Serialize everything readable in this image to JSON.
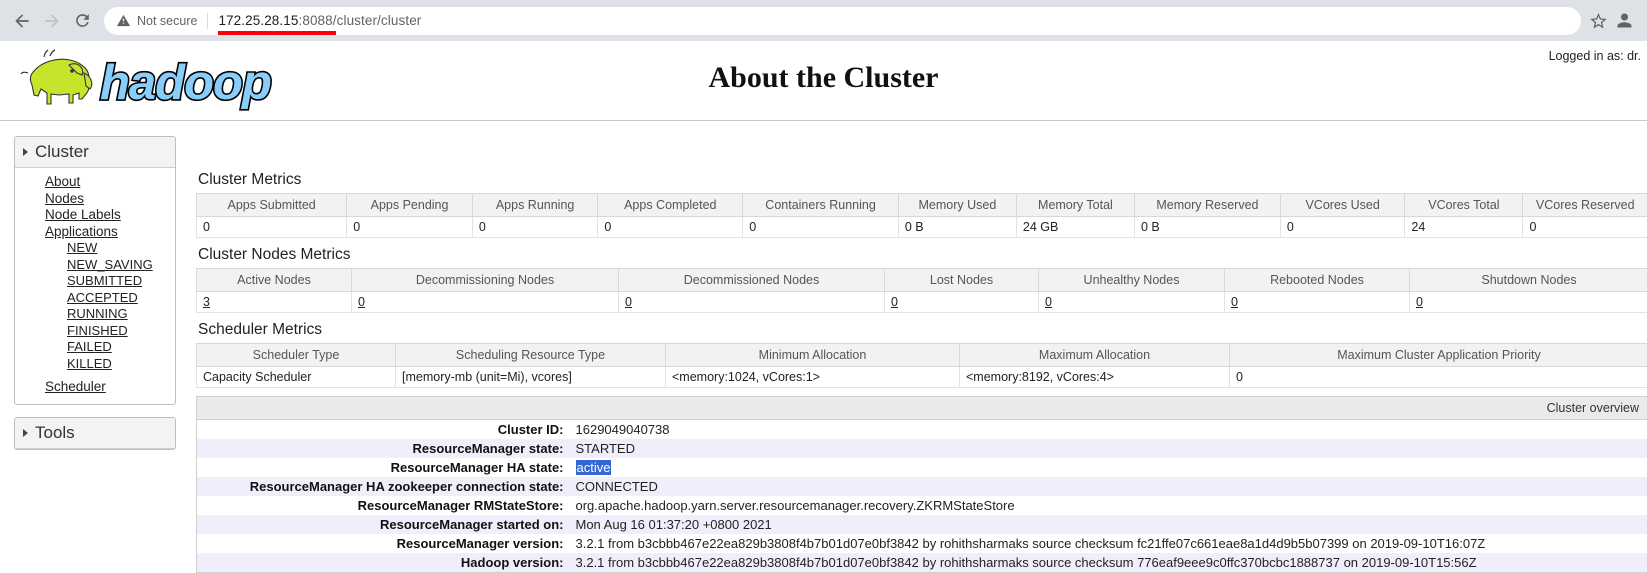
{
  "browser": {
    "back_label": "Back",
    "forward_label": "Forward",
    "reload_label": "Reload",
    "security_label": "Not secure",
    "url_host": "172.25.28.15",
    "url_rest": ":8088/cluster/cluster",
    "bookmark_label": "Bookmark this tab",
    "profile_label": "Profile"
  },
  "header": {
    "logo_text": "hadoop",
    "title": "About the Cluster",
    "logged_in": "Logged in as: dr."
  },
  "sidebar": {
    "cluster": {
      "heading": "Cluster",
      "items": [
        {
          "label": "About",
          "sub": false
        },
        {
          "label": "Nodes",
          "sub": false
        },
        {
          "label": "Node Labels",
          "sub": false
        },
        {
          "label": "Applications",
          "sub": false
        },
        {
          "label": "NEW",
          "sub": true
        },
        {
          "label": "NEW_SAVING",
          "sub": true
        },
        {
          "label": "SUBMITTED",
          "sub": true
        },
        {
          "label": "ACCEPTED",
          "sub": true
        },
        {
          "label": "RUNNING",
          "sub": true
        },
        {
          "label": "FINISHED",
          "sub": true
        },
        {
          "label": "FAILED",
          "sub": true
        },
        {
          "label": "KILLED",
          "sub": true
        },
        {
          "label": "Scheduler",
          "sub": false
        }
      ]
    },
    "tools": {
      "heading": "Tools"
    }
  },
  "cluster_metrics": {
    "title": "Cluster Metrics",
    "headers": [
      "Apps Submitted",
      "Apps Pending",
      "Apps Running",
      "Apps Completed",
      "Containers Running",
      "Memory Used",
      "Memory Total",
      "Memory Reserved",
      "VCores Used",
      "VCores Total",
      "VCores Reserved"
    ],
    "values": [
      "0",
      "0",
      "0",
      "0",
      "0",
      "0 B",
      "24 GB",
      "0 B",
      "0",
      "24",
      "0"
    ]
  },
  "nodes_metrics": {
    "title": "Cluster Nodes Metrics",
    "headers": [
      "Active Nodes",
      "Decommissioning Nodes",
      "Decommissioned Nodes",
      "Lost Nodes",
      "Unhealthy Nodes",
      "Rebooted Nodes",
      "Shutdown Nodes"
    ],
    "values": [
      "3",
      "0",
      "0",
      "0",
      "0",
      "0",
      "0"
    ]
  },
  "scheduler_metrics": {
    "title": "Scheduler Metrics",
    "headers": [
      "Scheduler Type",
      "Scheduling Resource Type",
      "Minimum Allocation",
      "Maximum Allocation",
      "Maximum Cluster Application Priority"
    ],
    "values": [
      "Capacity Scheduler",
      "[memory-mb (unit=Mi), vcores]",
      "<memory:1024, vCores:1>",
      "<memory:8192, vCores:4>",
      "0"
    ]
  },
  "cluster_overview": {
    "caption": "Cluster overview",
    "rows": [
      {
        "key": "Cluster ID:",
        "value": "1629049040738",
        "highlight": false
      },
      {
        "key": "ResourceManager state:",
        "value": "STARTED",
        "highlight": false
      },
      {
        "key": "ResourceManager HA state:",
        "value": "active",
        "highlight": true
      },
      {
        "key": "ResourceManager HA zookeeper connection state:",
        "value": "CONNECTED",
        "highlight": false
      },
      {
        "key": "ResourceManager RMStateStore:",
        "value": "org.apache.hadoop.yarn.server.resourcemanager.recovery.ZKRMStateStore",
        "highlight": false
      },
      {
        "key": "ResourceManager started on:",
        "value": "Mon Aug 16 01:37:20 +0800 2021",
        "highlight": false
      },
      {
        "key": "ResourceManager version:",
        "value": "3.2.1 from b3cbbb467e22ea829b3808f4b7b01d07e0bf3842 by rohithsharmaks source checksum fc21ffe07c661eae8a1d4d9b5b07399 on 2019-09-10T16:07Z",
        "highlight": false
      },
      {
        "key": "Hadoop version:",
        "value": "3.2.1 from b3cbbb467e22ea829b3808f4b7b01d07e0bf3842 by rohithsharmaks source checksum 776eaf9eee9c0ffc370bcbc1888737 on 2019-09-10T15:56Z",
        "highlight": false
      }
    ]
  },
  "colors": {
    "accent_blue": "#3367d6",
    "url_underline_red": "#fb0007",
    "logo_green": "#c5e52c",
    "logo_blue": "#87cefa"
  }
}
